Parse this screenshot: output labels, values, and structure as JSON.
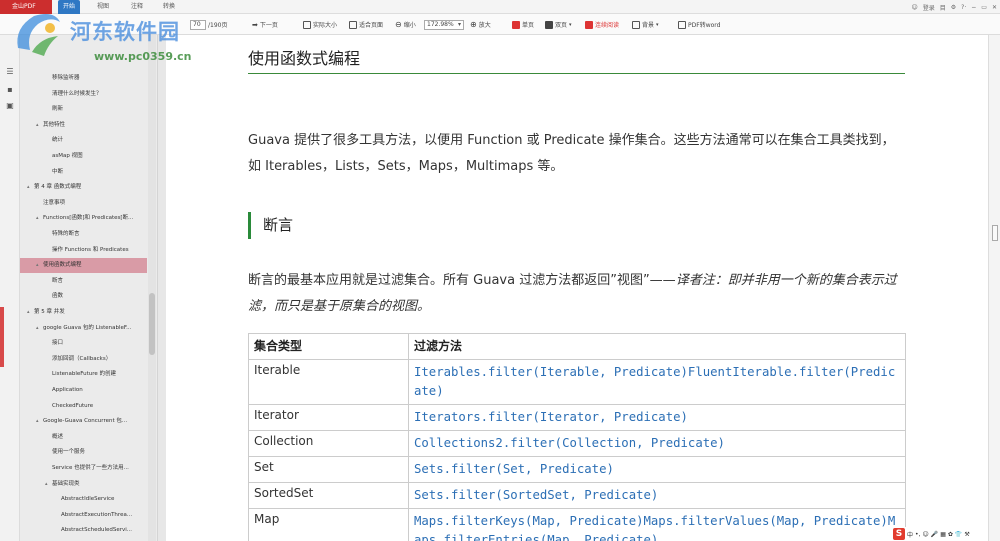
{
  "titlebar": {
    "app": "金山PDF",
    "tabs": [
      "开始",
      "视图",
      "注释",
      "转换"
    ],
    "active_tab": 0,
    "right": [
      "登录",
      "目",
      "⚙",
      "?·",
      "−",
      "▭",
      "✕"
    ]
  },
  "toolbar": {
    "page_value": "70",
    "page_total": "/190页",
    "next": "下一页",
    "actual": "实际大小",
    "fit": "适合页面",
    "zoom_out": "缩小",
    "zoom": "172.98%",
    "zoom_in": "放大",
    "single": "单页",
    "double": "双页",
    "continuous": "连续阅读",
    "background": "背景",
    "pdf2word": "PDF转word"
  },
  "watermark": {
    "name": "河东软件园",
    "url": "www.pc0359.cn"
  },
  "sidebar": {
    "items": [
      {
        "text": "移除监听器",
        "indent": 3
      },
      {
        "text": "清理什么时候发生？",
        "indent": 3
      },
      {
        "text": "刷新",
        "indent": 3
      },
      {
        "text": "其他特性",
        "indent": 2,
        "arrow": "▴"
      },
      {
        "text": "统计",
        "indent": 3
      },
      {
        "text": "asMap 视图",
        "indent": 3
      },
      {
        "text": "中断",
        "indent": 3
      },
      {
        "text": "第 4 章 函数式编程",
        "indent": 1,
        "arrow": "▴"
      },
      {
        "text": "注意事项",
        "indent": 2
      },
      {
        "text": "Functions[函数]和 Predicates[断...",
        "indent": 2,
        "arrow": "▴"
      },
      {
        "text": "特殊的断言",
        "indent": 3
      },
      {
        "text": "操作 Functions 和 Predicates",
        "indent": 3
      },
      {
        "text": "使用函数式编程",
        "indent": 2,
        "arrow": "▴",
        "selected": true
      },
      {
        "text": "断言",
        "indent": 3
      },
      {
        "text": "函数",
        "indent": 3
      },
      {
        "text": "第 5 章 并发",
        "indent": 1,
        "arrow": "▴"
      },
      {
        "text": "google Guava 包的 ListenableF...",
        "indent": 2,
        "arrow": "▴"
      },
      {
        "text": "接口",
        "indent": 3
      },
      {
        "text": "添加回调（Callbacks）",
        "indent": 3
      },
      {
        "text": "ListenableFuture 的创建",
        "indent": 3
      },
      {
        "text": "Application",
        "indent": 3
      },
      {
        "text": "CheckedFuture",
        "indent": 3
      },
      {
        "text": "Google-Guava Concurrent 包...",
        "indent": 2,
        "arrow": "▴"
      },
      {
        "text": "概述",
        "indent": 3
      },
      {
        "text": "使用一个服务",
        "indent": 3
      },
      {
        "text": "Service 也提供了一些方法用...",
        "indent": 3
      },
      {
        "text": "基础实现类",
        "indent": 3,
        "arrow": "▴"
      },
      {
        "text": "AbstractIdleService",
        "indent": 4
      },
      {
        "text": "AbstractExecutionThrea...",
        "indent": 4
      },
      {
        "text": "AbstractScheduledServi...",
        "indent": 4
      }
    ]
  },
  "doc": {
    "title": "使用函数式编程",
    "intro": "Guava 提供了很多工具方法，以便用 Function 或 Predicate 操作集合。这些方法通常可以在集合工具类找到，如 Iterables，Lists，Sets，Maps，Multimaps 等。",
    "section": "断言",
    "p2_a": "断言的最基本应用就是过滤集合。所有 Guava 过滤方法都返回”视图”——",
    "p2_b": "译者注：即并非用一个新的集合表示过滤，而只是基于原集合的视图。",
    "table": {
      "headers": [
        "集合类型",
        "过滤方法"
      ],
      "rows": [
        [
          "Iterable",
          "Iterables.filter(Iterable, Predicate)FluentIterable.filter(Predicate)"
        ],
        [
          "Iterator",
          "Iterators.filter(Iterator, Predicate)"
        ],
        [
          "Collection",
          "Collections2.filter(Collection, Predicate)"
        ],
        [
          "Set",
          "Sets.filter(Set, Predicate)"
        ],
        [
          "SortedSet",
          "Sets.filter(SortedSet, Predicate)"
        ],
        [
          "Map",
          "Maps.filterKeys(Map, Predicate)Maps.filterValues(Map, Predicate)Maps.filterEntries(Map, Predicate)"
        ]
      ]
    }
  },
  "statusbar": {
    "label": "中",
    "items": [
      "•,",
      "☺",
      "🎤",
      "▦",
      "✿",
      "👕",
      "⚒"
    ]
  }
}
